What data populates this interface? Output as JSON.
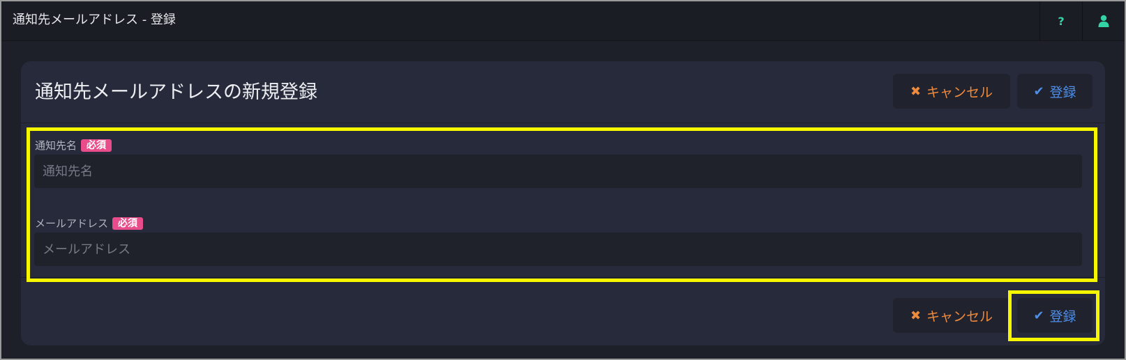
{
  "topbar": {
    "title": "通知先メールアドレス - 登録",
    "help_icon": "question-mark-icon",
    "user_icon": "user-icon",
    "accent_color": "#34d3a6"
  },
  "card": {
    "title": "通知先メールアドレスの新規登録",
    "cancel_label": "キャンセル",
    "save_label": "登録",
    "cancel_icon": "x-icon",
    "save_icon": "checkmark-icon"
  },
  "form": {
    "name_label": "通知先名",
    "name_required": "必須",
    "name_placeholder": "通知先名",
    "name_value": "",
    "email_label": "メールアドレス",
    "email_required": "必須",
    "email_placeholder": "メールアドレス",
    "email_value": ""
  },
  "footer": {
    "cancel_label": "キャンセル",
    "save_label": "登録"
  },
  "colors": {
    "cancel": "#f08a3c",
    "save": "#4f8fe8",
    "required_badge": "#e84c8a",
    "highlight": "#f6f600"
  }
}
